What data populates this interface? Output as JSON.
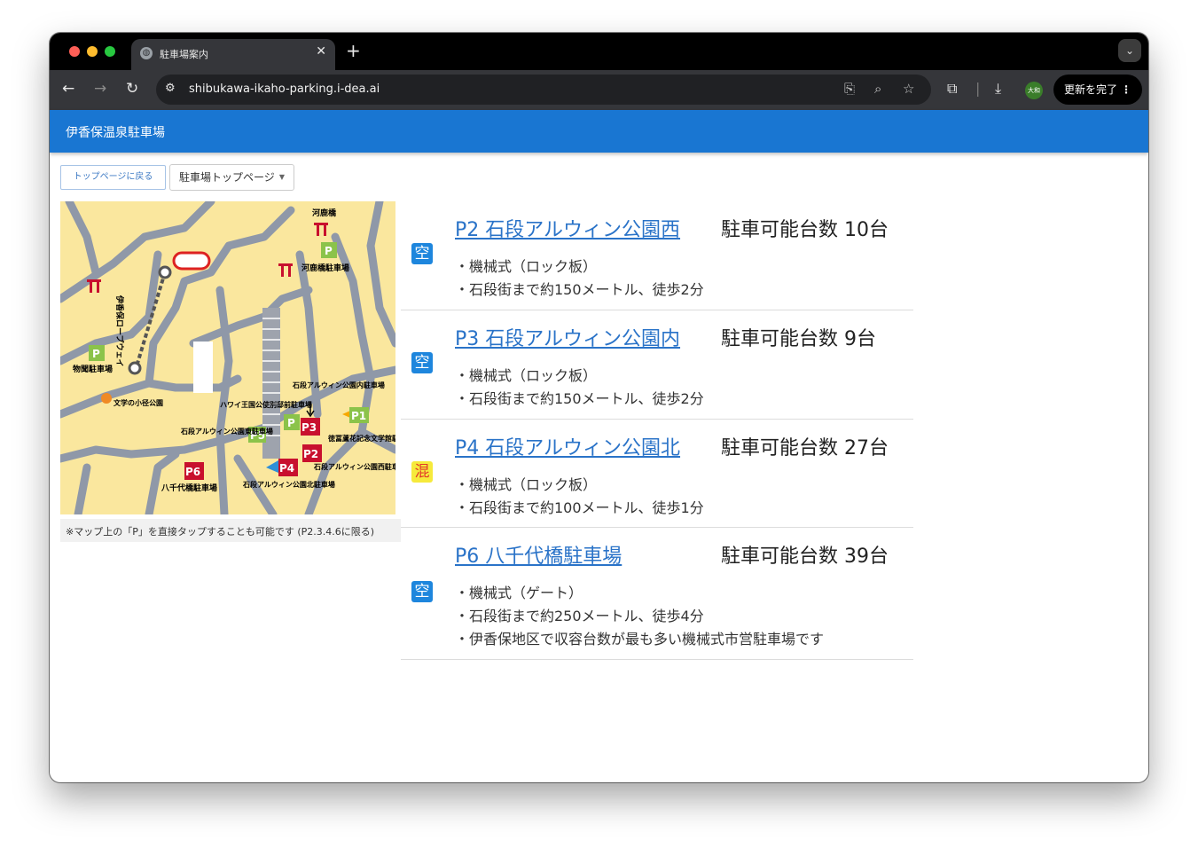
{
  "browser": {
    "tab_title": "駐車場案内",
    "url": "shibukawa-ikaho-parking.i-dea.ai",
    "profile_initials": "大和",
    "update_button": "更新を完了"
  },
  "app": {
    "title": "伊香保温泉駐車場"
  },
  "buttons": {
    "back_to_top": "トップページに戻る",
    "parking_top": "駐車場トップページ"
  },
  "map": {
    "caption": "※マップ上の「P」を直接タップすることも可能です (P2.3.4.6に限る)",
    "labels": {
      "kajika_bridge": "河鹿橋",
      "kajika_parking": "河鹿橋駐車場",
      "ropeway": "伊香保ロープウェイ",
      "bussan_parking": "物聞駐車場",
      "literature": "文学の小径公園",
      "hawaii": "ハワイ王国公使別邸前駐車場",
      "east_parking": "石段アルウィン公園東駐車場",
      "in_parking": "石段アルウィン公園内駐車場",
      "tokutomi": "徳冨蘆花記念文学館駐車場",
      "west_parking": "石段アルウィン公園西駐車場",
      "north_parking": "石段アルウィン公園北駐車場",
      "yachiyo_parking": "八千代橋駐車場"
    },
    "markers": {
      "p": "P",
      "p1": "P1",
      "p2": "P2",
      "p3": "P3",
      "p4": "P4",
      "p5": "P5",
      "p6": "P6"
    }
  },
  "lots": [
    {
      "status": "空",
      "name": "P2 石段アルウィン公園西",
      "capacity": "駐車可能台数 10台",
      "details": [
        "・機械式（ロック板）",
        "・石段街まで約150メートル、徒歩2分"
      ]
    },
    {
      "status": "空",
      "name": "P3 石段アルウィン公園内",
      "capacity": "駐車可能台数 9台",
      "details": [
        "・機械式（ロック板）",
        "・石段街まで約150メートル、徒歩2分"
      ]
    },
    {
      "status": "混",
      "name": "P4 石段アルウィン公園北",
      "capacity": "駐車可能台数 27台",
      "details": [
        "・機械式（ロック板）",
        "・石段街まで約100メートル、徒歩1分"
      ]
    },
    {
      "status": "空",
      "name": "P6 八千代橋駐車場",
      "capacity": "駐車可能台数 39台",
      "details": [
        "・機械式（ゲート）",
        "・石段街まで約250メートル、徒歩4分",
        "・伊香保地区で収容台数が最も多い機械式市営駐車場です"
      ]
    }
  ],
  "colors": {
    "appbar": "#1976d2",
    "link": "#2a73c8",
    "status_empty": "#1e86dd",
    "status_busy": "#f6ea3c"
  }
}
